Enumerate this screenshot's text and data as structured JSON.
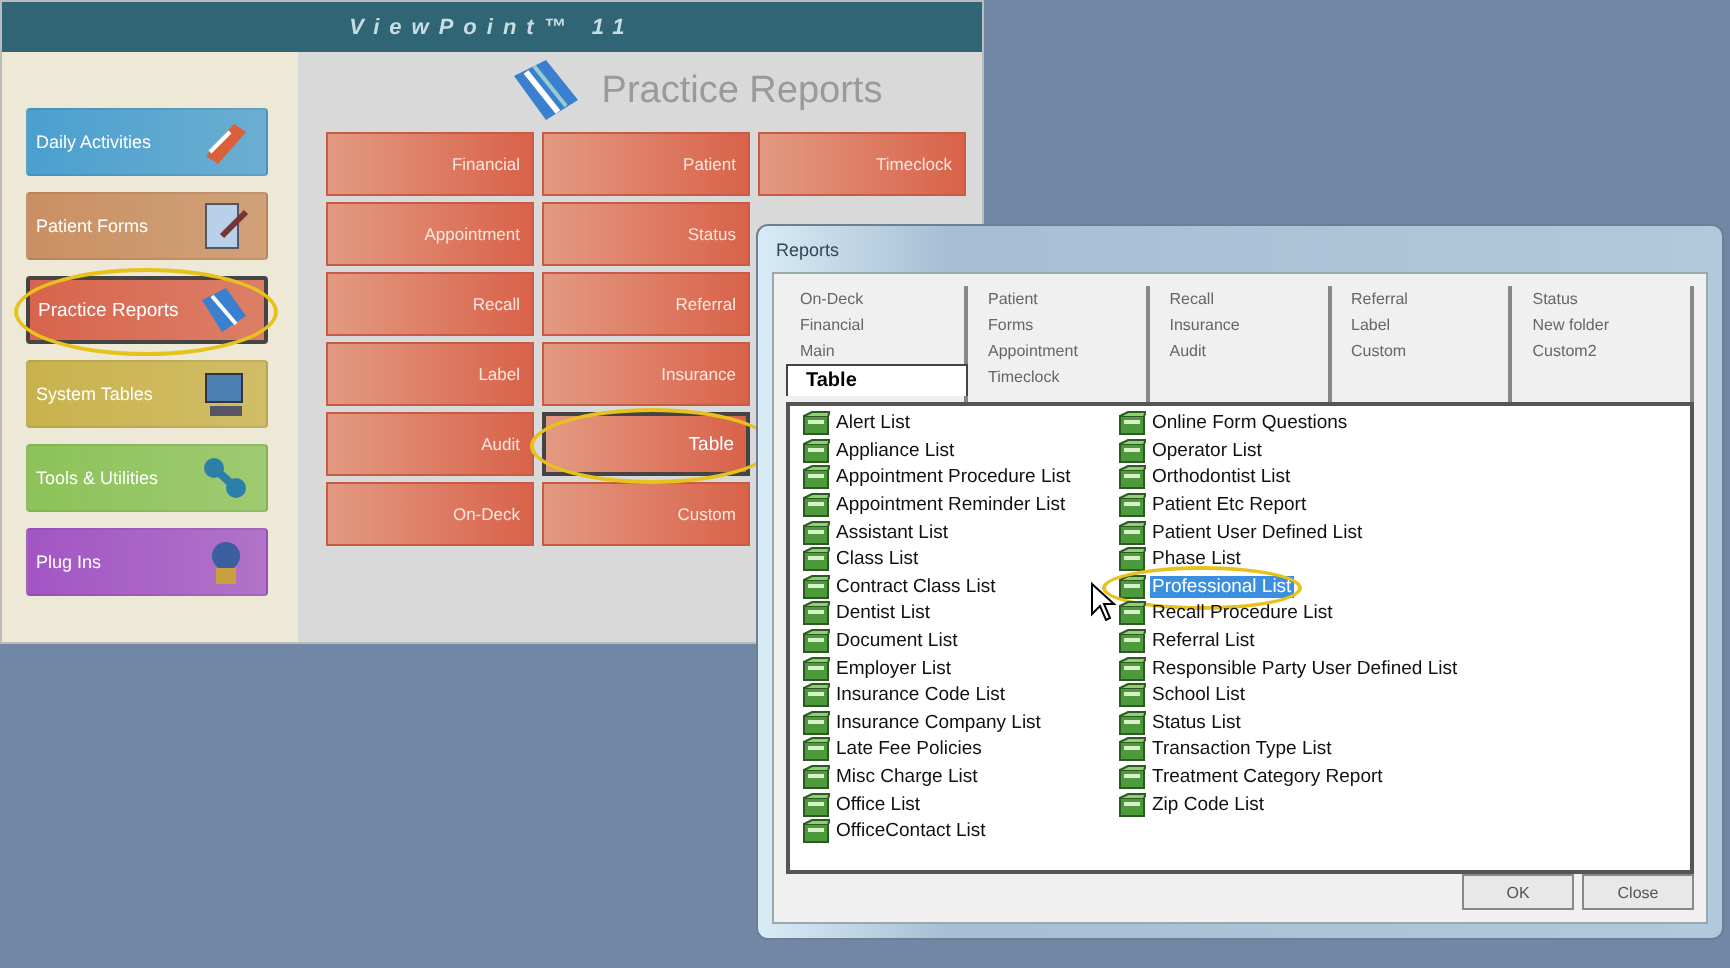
{
  "main_window": {
    "title": "ViewPoint™ 11",
    "heading": "Practice Reports",
    "sidebar": [
      {
        "label": "Daily Activities",
        "color": "#4a9fcf",
        "selected": false
      },
      {
        "label": "Patient Forms",
        "color": "#c98f62",
        "selected": false
      },
      {
        "label": "Practice Reports",
        "color": "#d8644c",
        "selected": true
      },
      {
        "label": "System Tables",
        "color": "#c9b24c",
        "selected": false
      },
      {
        "label": "Tools & Utilities",
        "color": "#8cc258",
        "selected": false
      },
      {
        "label": "Plug Ins",
        "color": "#a255c4",
        "selected": false
      }
    ],
    "report_button_columns": [
      [
        {
          "label": "Financial",
          "selected": false
        },
        {
          "label": "Appointment",
          "selected": false
        },
        {
          "label": "Recall",
          "selected": false
        },
        {
          "label": "Label",
          "selected": false
        },
        {
          "label": "Audit",
          "selected": false
        },
        {
          "label": "On-Deck",
          "selected": false
        }
      ],
      [
        {
          "label": "Patient",
          "selected": false
        },
        {
          "label": "Status",
          "selected": false
        },
        {
          "label": "Referral",
          "selected": false
        },
        {
          "label": "Insurance",
          "selected": false
        },
        {
          "label": "Table",
          "selected": true
        },
        {
          "label": "Custom",
          "selected": false
        }
      ],
      [
        {
          "label": "Timeclock",
          "selected": false
        }
      ]
    ]
  },
  "dialog": {
    "title": "Reports",
    "tab_columns": [
      [
        {
          "label": "On-Deck",
          "selected": false
        },
        {
          "label": "Financial",
          "selected": false
        },
        {
          "label": "Main",
          "selected": false
        },
        {
          "label": "Table",
          "selected": true
        }
      ],
      [
        {
          "label": "Patient",
          "selected": false
        },
        {
          "label": "Forms",
          "selected": false
        },
        {
          "label": "Appointment",
          "selected": false
        },
        {
          "label": "Timeclock",
          "selected": false
        }
      ],
      [
        {
          "label": "Recall",
          "selected": false
        },
        {
          "label": "Insurance",
          "selected": false
        },
        {
          "label": "Audit",
          "selected": false
        }
      ],
      [
        {
          "label": "Referral",
          "selected": false
        },
        {
          "label": "Label",
          "selected": false
        },
        {
          "label": "Custom",
          "selected": false
        }
      ],
      [
        {
          "label": "Status",
          "selected": false
        },
        {
          "label": "New folder",
          "selected": false
        },
        {
          "label": "Custom2",
          "selected": false
        }
      ]
    ],
    "report_columns": [
      [
        {
          "label": "Alert List",
          "selected": false
        },
        {
          "label": "Appliance List",
          "selected": false
        },
        {
          "label": "Appointment Procedure List",
          "selected": false
        },
        {
          "label": "Appointment Reminder List",
          "selected": false
        },
        {
          "label": "Assistant List",
          "selected": false
        },
        {
          "label": "Class List",
          "selected": false
        },
        {
          "label": "Contract Class List",
          "selected": false
        },
        {
          "label": "Dentist List",
          "selected": false
        },
        {
          "label": "Document List",
          "selected": false
        },
        {
          "label": "Employer List",
          "selected": false
        },
        {
          "label": "Insurance Code List",
          "selected": false
        },
        {
          "label": "Insurance Company List",
          "selected": false
        },
        {
          "label": "Late Fee Policies",
          "selected": false
        },
        {
          "label": "Misc Charge List",
          "selected": false
        },
        {
          "label": "Office List",
          "selected": false
        },
        {
          "label": "OfficeContact List",
          "selected": false
        }
      ],
      [
        {
          "label": "Online Form Questions",
          "selected": false
        },
        {
          "label": "Operator List",
          "selected": false
        },
        {
          "label": "Orthodontist List",
          "selected": false
        },
        {
          "label": "Patient Etc Report",
          "selected": false
        },
        {
          "label": "Patient User Defined List",
          "selected": false
        },
        {
          "label": "Phase List",
          "selected": false
        },
        {
          "label": "Professional List",
          "selected": true
        },
        {
          "label": "Recall Procedure List",
          "selected": false
        },
        {
          "label": "Referral List",
          "selected": false
        },
        {
          "label": "Responsible Party User Defined List",
          "selected": false
        },
        {
          "label": "School List",
          "selected": false
        },
        {
          "label": "Status List",
          "selected": false
        },
        {
          "label": "Transaction Type List",
          "selected": false
        },
        {
          "label": "Treatment Category Report",
          "selected": false
        },
        {
          "label": "Zip Code List",
          "selected": false
        }
      ]
    ],
    "buttons": [
      "OK",
      "Close"
    ]
  }
}
